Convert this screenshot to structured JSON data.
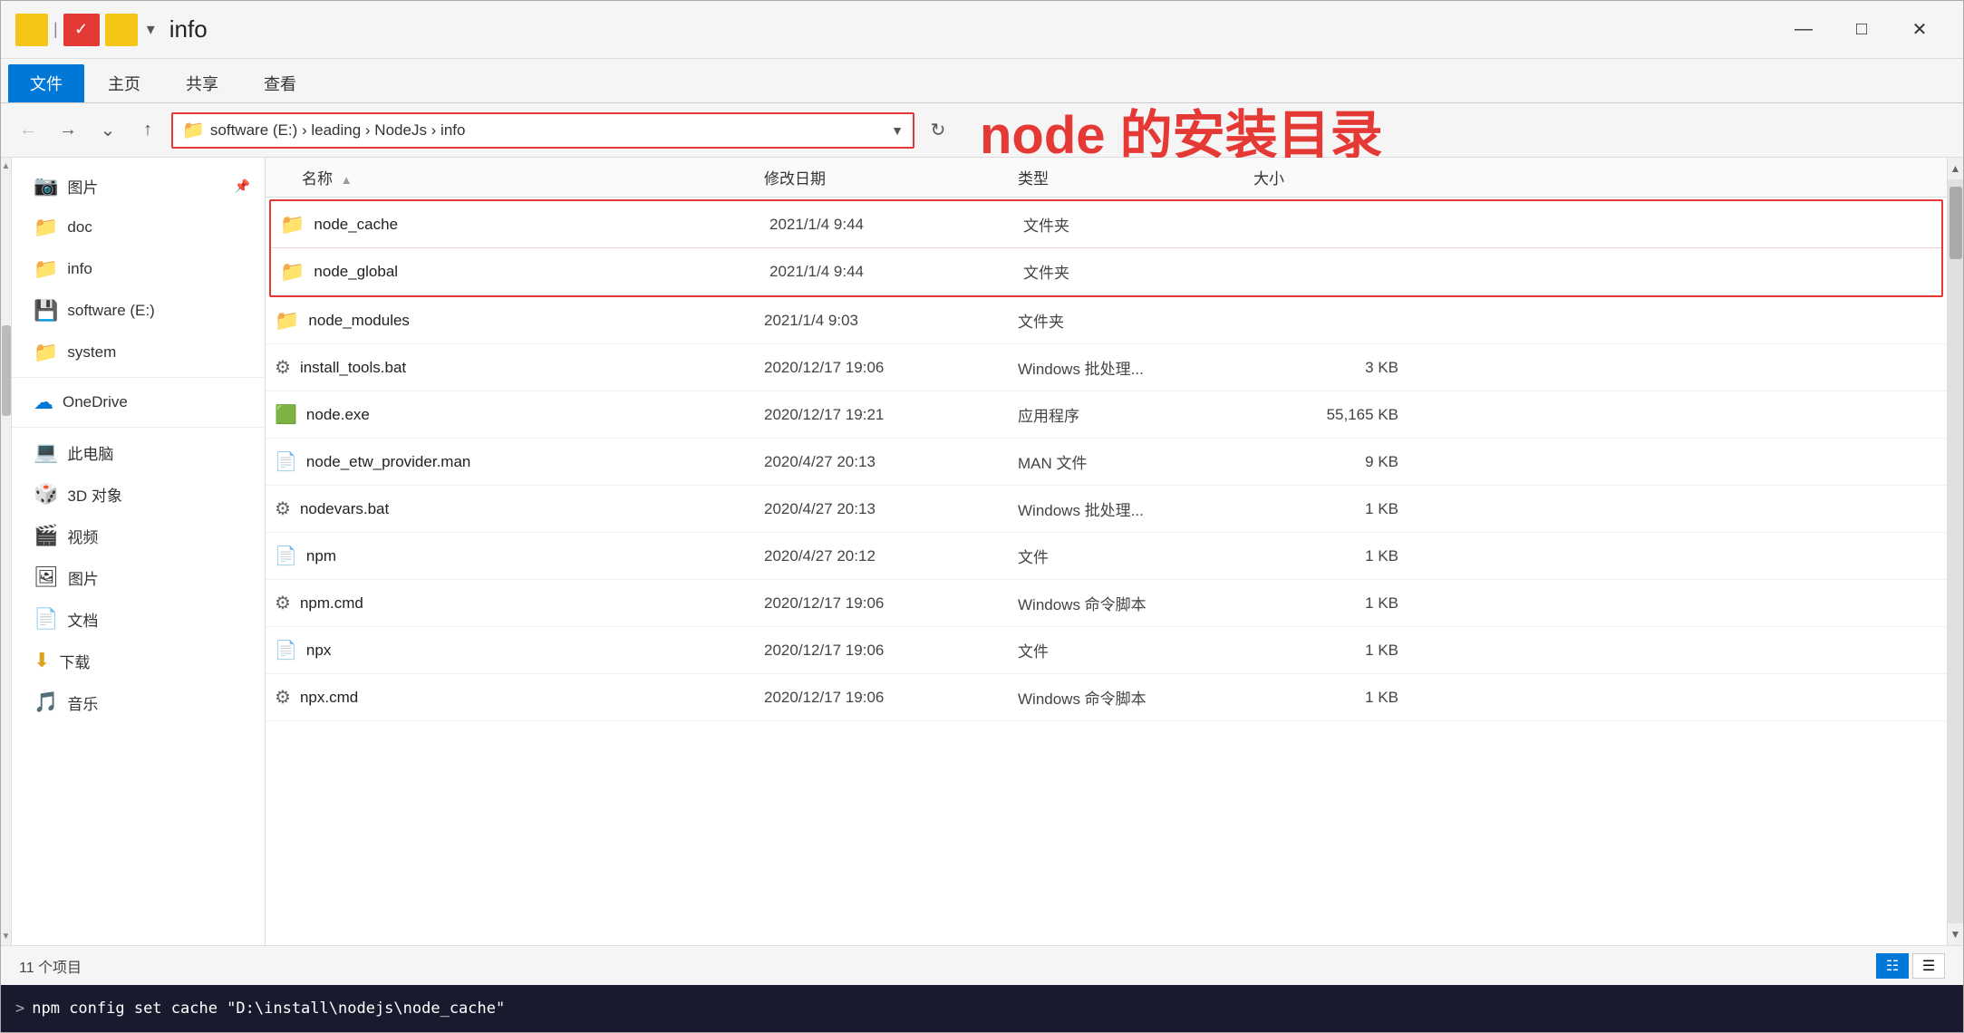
{
  "window": {
    "title": "info",
    "controls": {
      "minimize": "—",
      "maximize": "□",
      "close": "✕"
    }
  },
  "ribbon": {
    "tabs": [
      "文件",
      "主页",
      "共享",
      "查看"
    ]
  },
  "address_bar": {
    "path": "software (E:) › leading › NodeJs › info",
    "path_parts": [
      "software (E:)",
      "leading",
      "NodeJs",
      "info"
    ]
  },
  "annotation": {
    "text": "node 的安装目录"
  },
  "sidebar": {
    "items": [
      {
        "icon": "📷",
        "label": "图片",
        "pinned": true
      },
      {
        "icon": "📁",
        "label": "doc"
      },
      {
        "icon": "📁",
        "label": "info",
        "selected": true
      },
      {
        "icon": "💾",
        "label": "software (E:)"
      },
      {
        "icon": "📁",
        "label": "system"
      },
      {
        "icon": "☁",
        "label": "OneDrive"
      },
      {
        "icon": "💻",
        "label": "此电脑"
      },
      {
        "icon": "🎲",
        "label": "3D 对象"
      },
      {
        "icon": "🎬",
        "label": "视频"
      },
      {
        "icon": "🖼",
        "label": "图片"
      },
      {
        "icon": "📄",
        "label": "文档"
      },
      {
        "icon": "⬇",
        "label": "下载"
      },
      {
        "icon": "🎵",
        "label": "音乐"
      }
    ]
  },
  "file_list": {
    "columns": [
      "名称",
      "修改日期",
      "类型",
      "大小"
    ],
    "rows": [
      {
        "name": "node_cache",
        "date": "2021/1/4 9:44",
        "type": "文件夹",
        "size": "",
        "icon_type": "folder",
        "highlighted": true
      },
      {
        "name": "node_global",
        "date": "2021/1/4 9:44",
        "type": "文件夹",
        "size": "",
        "icon_type": "folder",
        "highlighted": true
      },
      {
        "name": "node_modules",
        "date": "2021/1/4 9:03",
        "type": "文件夹",
        "size": "",
        "icon_type": "folder",
        "highlighted": false
      },
      {
        "name": "install_tools.bat",
        "date": "2020/12/17 19:06",
        "type": "Windows 批处理...",
        "size": "3 KB",
        "icon_type": "bat",
        "highlighted": false
      },
      {
        "name": "node.exe",
        "date": "2020/12/17 19:21",
        "type": "应用程序",
        "size": "55,165 KB",
        "icon_type": "exe",
        "highlighted": false
      },
      {
        "name": "node_etw_provider.man",
        "date": "2020/4/27 20:13",
        "type": "MAN 文件",
        "size": "9 KB",
        "icon_type": "man",
        "highlighted": false
      },
      {
        "name": "nodevars.bat",
        "date": "2020/4/27 20:13",
        "type": "Windows 批处理...",
        "size": "1 KB",
        "icon_type": "bat",
        "highlighted": false
      },
      {
        "name": "npm",
        "date": "2020/4/27 20:12",
        "type": "文件",
        "size": "1 KB",
        "icon_type": "file",
        "highlighted": false
      },
      {
        "name": "npm.cmd",
        "date": "2020/12/17 19:06",
        "type": "Windows 命令脚本",
        "size": "1 KB",
        "icon_type": "bat",
        "highlighted": false
      },
      {
        "name": "npx",
        "date": "2020/12/17 19:06",
        "type": "文件",
        "size": "1 KB",
        "icon_type": "file",
        "highlighted": false
      },
      {
        "name": "npx.cmd",
        "date": "2020/12/17 19:06",
        "type": "Windows 命令脚本",
        "size": "1 KB",
        "icon_type": "bat",
        "highlighted": false
      }
    ]
  },
  "status_bar": {
    "count_label": "11 个项目"
  },
  "terminal": {
    "prompt": ">",
    "command": "npm config set cache \"D:\\install\\nodejs\\node_cache\""
  }
}
